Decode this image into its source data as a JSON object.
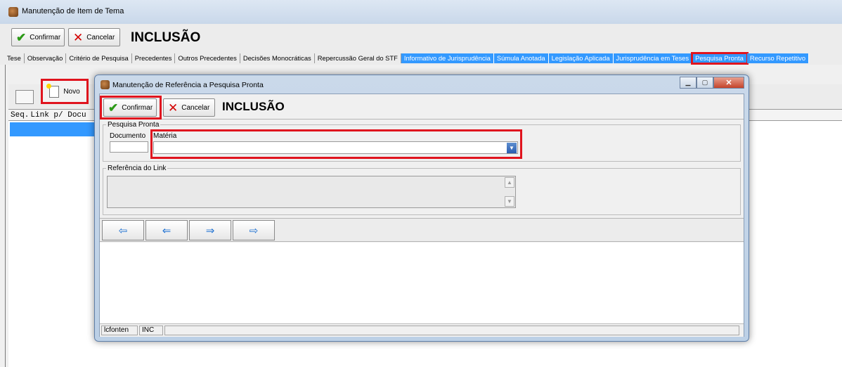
{
  "main_window": {
    "title": "Manutenção de Item de Tema",
    "toolbar": {
      "confirm_label": "Confirmar",
      "cancel_label": "Cancelar",
      "mode_label": "INCLUSÃO"
    },
    "tabs": [
      {
        "label": "Tese",
        "state": "normal"
      },
      {
        "label": "Observação",
        "state": "normal"
      },
      {
        "label": "Critério de Pesquisa",
        "state": "normal"
      },
      {
        "label": "Precedentes",
        "state": "normal"
      },
      {
        "label": "Outros Precedentes",
        "state": "normal"
      },
      {
        "label": "Decisões Monocráticas",
        "state": "normal"
      },
      {
        "label": "Repercussão Geral do STF",
        "state": "normal"
      },
      {
        "label": "Informativo de Jurisprudência",
        "state": "filled"
      },
      {
        "label": "Súmula Anotada",
        "state": "filled"
      },
      {
        "label": "Legislação Aplicada",
        "state": "filled"
      },
      {
        "label": "Jurisprudência em Teses",
        "state": "filled"
      },
      {
        "label": "Pesquisa Pronta",
        "state": "selected"
      },
      {
        "label": "Recurso Repetitivo",
        "state": "filled"
      }
    ],
    "novo_label": "Novo",
    "grid_headers": [
      "Seq.",
      "Link p/ Docu"
    ]
  },
  "dialog": {
    "title": "Manutenção de Referência a Pesquisa Pronta",
    "toolbar": {
      "confirm_label": "Confirmar",
      "cancel_label": "Cancelar",
      "mode_label": "INCLUSÃO"
    },
    "group_pesquisa": {
      "legend": "Pesquisa Pronta",
      "documento_label": "Documento",
      "documento_value": "",
      "materia_label": "Matéria",
      "materia_value": ""
    },
    "group_referencia": {
      "legend": "Referência do Link",
      "value": ""
    },
    "nav": {
      "first": "⇦",
      "prev": "⇐",
      "next": "⇒",
      "last": "⇨"
    },
    "status": {
      "user": "lcfonten",
      "mode": "INC"
    }
  },
  "colors": {
    "accent": "#3399ff",
    "highlight": "#e0141e",
    "confirm_green": "#2c9a17",
    "cancel_red": "#d40000"
  }
}
